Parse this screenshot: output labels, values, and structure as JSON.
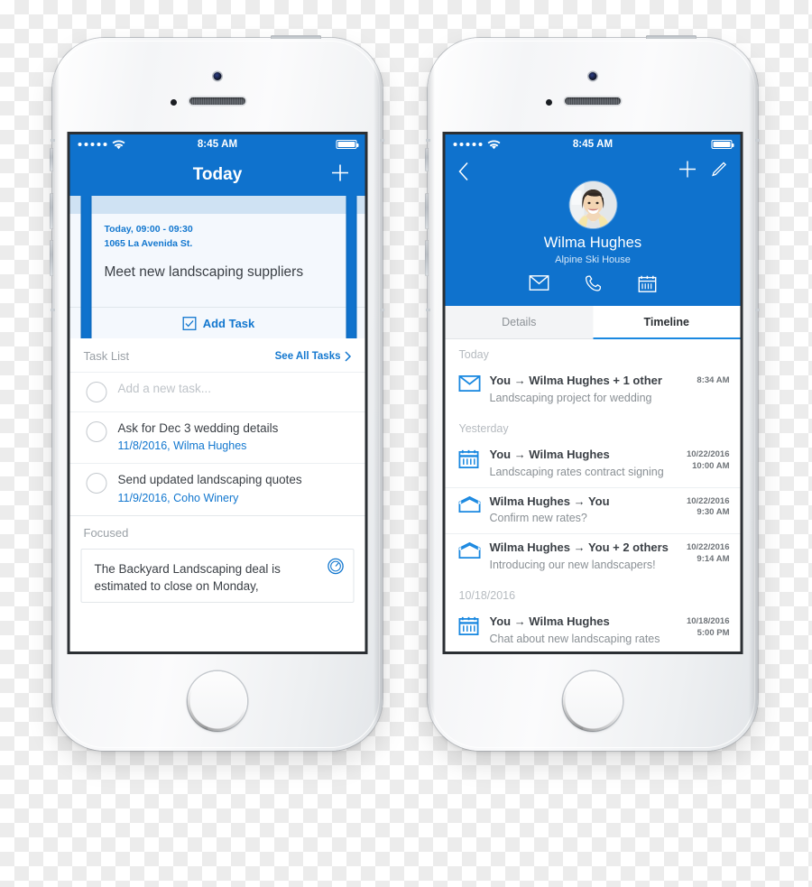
{
  "statusbar": {
    "signal_dots": 5,
    "wifi_icon": "wifi-icon",
    "time": "8:45 AM",
    "battery_icon": "battery-full-icon"
  },
  "left_phone": {
    "nav": {
      "title": "Today",
      "add_icon": "plus-icon"
    },
    "carousel": {
      "cards": [
        {
          "when": "Today, 09:00 - 09:30",
          "where": "1065 La Avenida St.",
          "title": "Meet new landscaping suppliers",
          "footer_label": "Add Task",
          "footer_icon": "checkbox-icon"
        }
      ]
    },
    "task_list": {
      "heading": "Task List",
      "see_all_label": "See All Tasks",
      "see_all_icon": "chevron-right-icon",
      "new_task_placeholder": "Add a new task...",
      "tasks": [
        {
          "name": "Ask for Dec 3 wedding details",
          "meta": "11/8/2016, Wilma Hughes"
        },
        {
          "name": "Send updated landscaping quotes",
          "meta": "11/9/2016, Coho Winery"
        }
      ]
    },
    "focused": {
      "heading": "Focused",
      "card_text": "The Backyard Landscaping deal is estimated to close on Monday,",
      "card_icon": "gauge-icon"
    }
  },
  "right_phone": {
    "hero": {
      "back_icon": "chevron-left-icon",
      "add_icon": "plus-icon",
      "edit_icon": "pencil-icon",
      "avatar_icon": "contact-photo",
      "name": "Wilma Hughes",
      "organization": "Alpine Ski House",
      "actions": [
        {
          "icon": "mail-icon",
          "label": "Email"
        },
        {
          "icon": "phone-icon",
          "label": "Call"
        },
        {
          "icon": "calendar-icon",
          "label": "Schedule"
        }
      ]
    },
    "tabs": [
      {
        "label": "Details",
        "active": false
      },
      {
        "label": "Timeline",
        "active": true
      }
    ],
    "timeline": [
      {
        "group": "Today"
      },
      {
        "icon": "mail-closed-icon",
        "title": "You → Wilma Hughes + 1 other",
        "subtitle": "Landscaping project for wedding",
        "time": "8:34 AM"
      },
      {
        "group": "Yesterday"
      },
      {
        "icon": "calendar-icon",
        "title": "You → Wilma Hughes",
        "subtitle": "Landscaping rates contract signing",
        "time": "10/22/2016\n10:00 AM"
      },
      {
        "icon": "mail-open-icon",
        "title": "Wilma Hughes → You",
        "subtitle": "Confirm new rates?",
        "time": "10/22/2016\n9:30 AM"
      },
      {
        "icon": "mail-open-icon",
        "title": "Wilma Hughes → You + 2 others",
        "subtitle": "Introducing our new landscapers!",
        "time": "10/22/2016\n9:14 AM"
      },
      {
        "group": "10/18/2016"
      },
      {
        "icon": "calendar-icon",
        "title": "You → Wilma Hughes",
        "subtitle": "Chat about new landscaping rates",
        "time": "10/18/2016\n5:00 PM"
      }
    ]
  },
  "colors": {
    "brand_blue": "#0f72cd",
    "link_blue": "#1277cf",
    "card_bg": "#f4f8fd",
    "card_accent": "#cfe2f3",
    "muted_text": "#9aa0a6"
  }
}
